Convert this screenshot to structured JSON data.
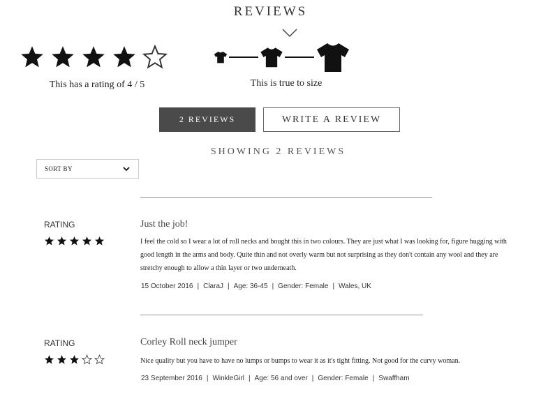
{
  "header": {
    "title": "REVIEWS"
  },
  "summary": {
    "rating": 4,
    "rating_max": 5,
    "rating_text": "This has a rating of 4 / 5",
    "fit_text": "This is true to size"
  },
  "buttons": {
    "reviews_label": "2 REVIEWS",
    "write_label": "WRITE A REVIEW"
  },
  "showing_text": "SHOWING 2 REVIEWS",
  "sort": {
    "label": "SORT BY"
  },
  "reviews": [
    {
      "rating_label": "RATING",
      "rating": 5,
      "title": "Just the job!",
      "body": "I feel the cold so I wear a lot of roll necks and bought this in two colours. They are just what I was looking for, figure hugging with good length in the arms and body. Quite thin and not overly warm but not surprising as they don't contain any wool and they are stretchy enough to allow a thin layer or two underneath.",
      "date": "15 October 2016",
      "author": "ClaraJ",
      "age": "Age: 36-45",
      "gender": "Gender: Female",
      "location": "Wales, UK"
    },
    {
      "rating_label": "RATING",
      "rating": 3,
      "title": "Corley Roll neck jumper",
      "body": "Nice quality but you have to have no lumps or bumps to wear it as it's tight fitting. Not good for the curvy woman.",
      "date": "23 September 2016",
      "author": "WinkleGirl",
      "age": "Age: 56 and over",
      "gender": "Gender: Female",
      "location": "Swaffham"
    }
  ]
}
